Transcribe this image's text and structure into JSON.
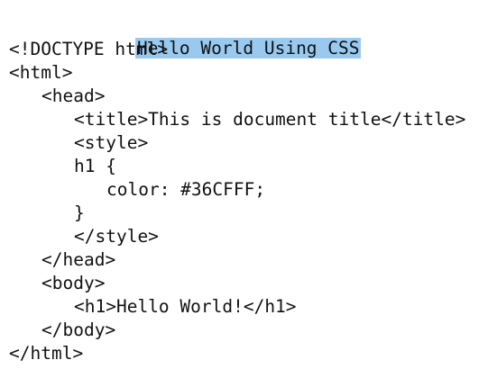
{
  "heading": {
    "text": "Hello World Using CSS",
    "highlight_color": "#99c9ef"
  },
  "code_lines": [
    "<!DOCTYPE html>",
    "<html>",
    "<head>",
    "<title>This is document title</title>",
    "<style>",
    "h1 {",
    "color: #36CFFF;",
    "}",
    "</style>",
    "</head>",
    "<body>",
    "<h1>Hello World!</h1>",
    "</body>",
    "</html>"
  ]
}
